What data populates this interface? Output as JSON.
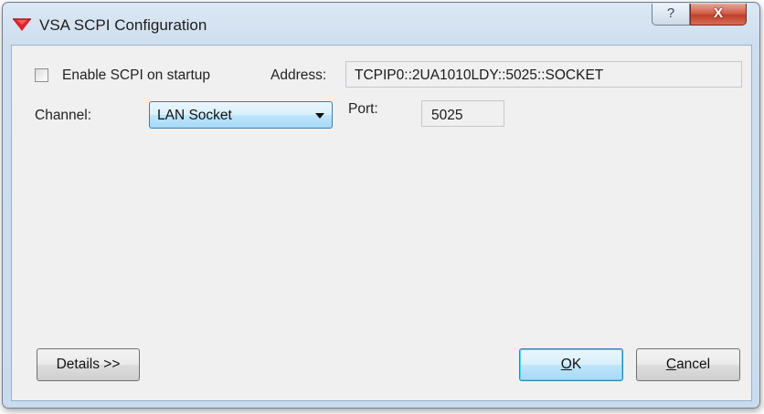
{
  "window": {
    "title": "VSA SCPI Configuration",
    "help_label": "?",
    "close_label": "X"
  },
  "form": {
    "enable_scpi_label": "Enable SCPI on startup",
    "enable_scpi_checked": false,
    "address_label": "Address:",
    "address_value": "TCPIP0::2UA1010LDY::5025::SOCKET",
    "channel_label": "Channel:",
    "channel_value": "LAN Socket",
    "port_label": "Port:",
    "port_value": "5025"
  },
  "buttons": {
    "details_label": "Details >>",
    "ok_accel": "O",
    "ok_rest": "K",
    "cancel_accel": "C",
    "cancel_rest": "ancel"
  },
  "colors": {
    "app_icon": "#d9252a",
    "close_button": "#c7472f",
    "focus_border": "#3c7fb1"
  }
}
